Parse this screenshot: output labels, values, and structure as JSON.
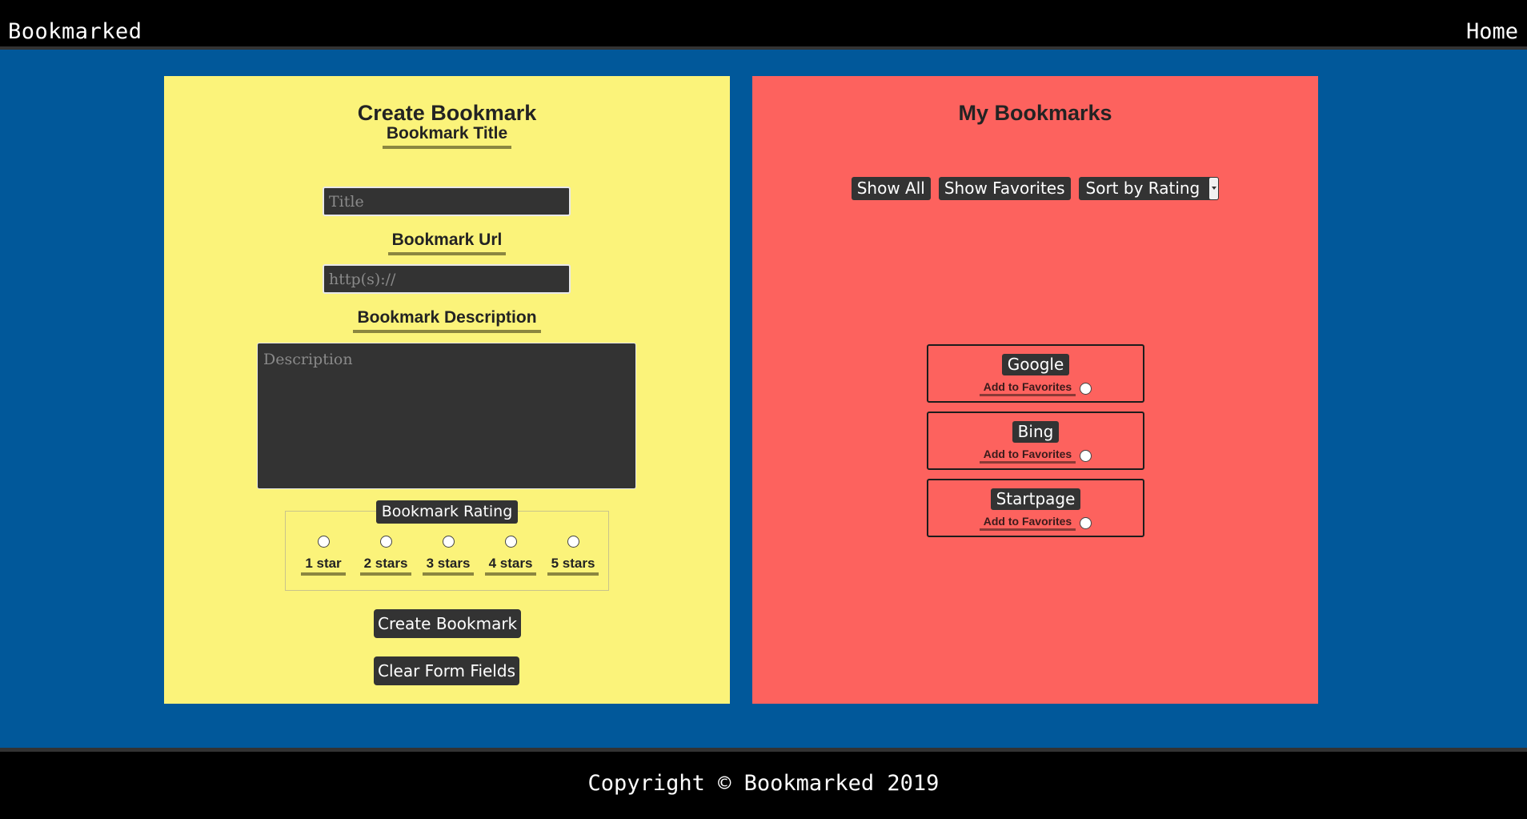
{
  "header": {
    "brand": "Bookmarked",
    "home_link": "Home"
  },
  "create_form": {
    "title": "Create Bookmark",
    "title_label": "Bookmark Title",
    "title_placeholder": "Title",
    "url_label": "Bookmark Url",
    "url_placeholder": "http(s)://",
    "description_label": "Bookmark Description",
    "description_placeholder": "Description",
    "rating_legend": "Bookmark Rating",
    "rating_options": [
      "1 star",
      "2 stars",
      "3 stars",
      "4 stars",
      "5 stars"
    ],
    "create_button": "Create Bookmark",
    "clear_button": "Clear Form Fields"
  },
  "bookmarks_panel": {
    "title": "My Bookmarks",
    "show_all": "Show All",
    "show_favorites": "Show Favorites",
    "sort_select": "Sort by Rating",
    "bookmarks": [
      {
        "name": "Google",
        "favorite_label": "Add to Favorites"
      },
      {
        "name": "Bing",
        "favorite_label": "Add to Favorites"
      },
      {
        "name": "Startpage",
        "favorite_label": "Add to Favorites"
      }
    ]
  },
  "footer": {
    "copyright": "Copyright © Bookmarked 2019"
  },
  "colors": {
    "page_bg": "#01589a",
    "bar_bg": "#000000",
    "create_panel_bg": "#fbf37a",
    "bookmarks_panel_bg": "#fd625e",
    "control_bg": "#333333"
  }
}
